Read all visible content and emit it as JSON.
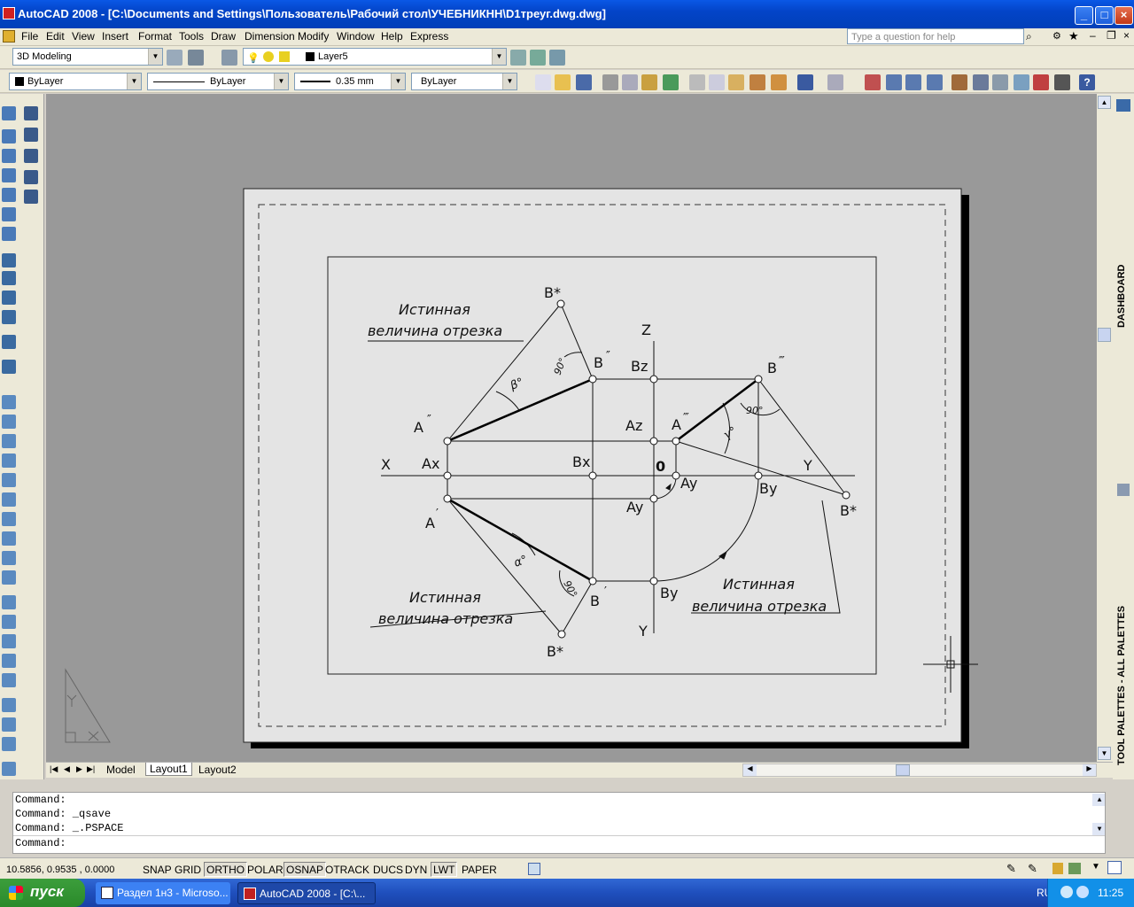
{
  "app": {
    "title": "AutoCAD 2008 - [C:\\Documents and Settings\\Пользователь\\Рабочий стол\\УЧЕБНИКНН\\D1треуг.dwg.dwg]"
  },
  "menu": [
    "File",
    "Edit",
    "View",
    "Insert",
    "Format",
    "Tools",
    "Draw",
    "Dimension",
    "Modify",
    "Window",
    "Help",
    "Express"
  ],
  "help_search": {
    "placeholder": "Type a question for help"
  },
  "toolbar": {
    "workspace": "3D Modeling",
    "layer": "Layer5",
    "color": "ByLayer",
    "linetype": "ByLayer",
    "lineweight": "0.35 mm",
    "plotstyle": "ByLayer"
  },
  "drawing": {
    "labels": {
      "b_star_top": "B*",
      "b_dbl": "B",
      "a_dbl": "A",
      "bz": "Bz",
      "z": "Z",
      "b_trip": "B",
      "a_trip": "A",
      "az": "Az",
      "x": "X",
      "ax": "Ax",
      "bx": "Bx",
      "o": "0",
      "y_right": "Y",
      "ay_r": "Ay",
      "by_r": "By",
      "ay": "Ay",
      "b_star_right": "B*",
      "a_prime": "A",
      "b_prime": "B",
      "by": "By",
      "y_bottom": "Y",
      "b_star_bottom": "B*",
      "ang90": "90°",
      "beta": "β°",
      "gamma": "γ°",
      "alpha": "α°"
    },
    "captions": {
      "tl1": "Истинная",
      "tl2": "величина отрезка",
      "bl1": "Истинная",
      "bl2": "величина отрезка",
      "br1": "Истинная",
      "br2": "величина отрезка"
    }
  },
  "layout_tabs": [
    "Model",
    "Layout1",
    "Layout2"
  ],
  "command_lines": [
    "Command:",
    "Command: _qsave",
    "Command: _.PSPACE"
  ],
  "command_prompt": "Command:",
  "status": {
    "coords": "10.5856, 0.9535 , 0.0000",
    "buttons": [
      {
        "label": "SNAP",
        "on": false
      },
      {
        "label": "GRID",
        "on": false
      },
      {
        "label": "ORTHO",
        "on": true
      },
      {
        "label": "POLAR",
        "on": false
      },
      {
        "label": "OSNAP",
        "on": true
      },
      {
        "label": "OTRACK",
        "on": false
      },
      {
        "label": "DUCS",
        "on": false
      },
      {
        "label": "DYN",
        "on": false
      },
      {
        "label": "LWT",
        "on": true
      },
      {
        "label": "PAPER",
        "on": false
      }
    ]
  },
  "palettes": {
    "dashboard": "DASHBOARD",
    "tool_palettes": "TOOL PALETTES - ALL PALETTES"
  },
  "taskbar": {
    "start": "пуск",
    "tasks": [
      "Раздел 1н3 - Microso...",
      "AutoCAD 2008 - [C:\\..."
    ],
    "lang": "RU",
    "clock": "11:25"
  }
}
